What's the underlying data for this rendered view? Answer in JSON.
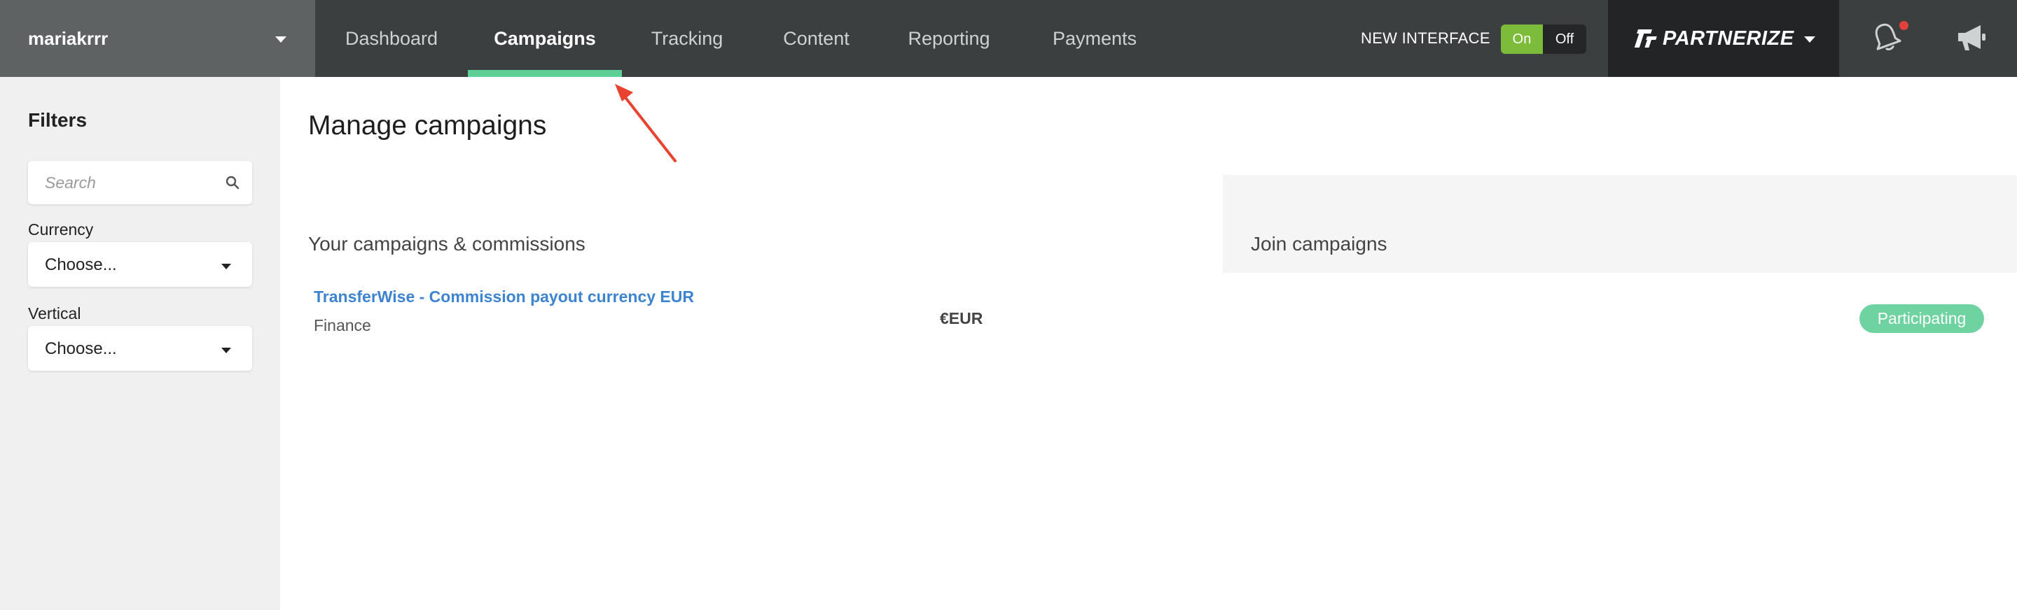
{
  "account": {
    "name": "mariakrrr"
  },
  "nav": {
    "items": [
      {
        "label": "Dashboard",
        "active": false
      },
      {
        "label": "Campaigns",
        "active": true
      },
      {
        "label": "Tracking",
        "active": false
      },
      {
        "label": "Content",
        "active": false
      },
      {
        "label": "Reporting",
        "active": false
      },
      {
        "label": "Payments",
        "active": false
      }
    ]
  },
  "interface_toggle": {
    "label": "NEW INTERFACE",
    "on_label": "On",
    "off_label": "Off",
    "selected": "On"
  },
  "brand": {
    "name": "PARTNERIZE"
  },
  "icons": {
    "account_caret": "chevron-down-icon",
    "bell": "bell-icon",
    "megaphone": "megaphone-icon",
    "search": "search-icon",
    "pointer": "arrow-annotation-icon"
  },
  "notifications": {
    "has_unread": true
  },
  "sidebar": {
    "title": "Filters",
    "search_placeholder": "Search",
    "currency": {
      "label": "Currency",
      "value": "Choose..."
    },
    "vertical": {
      "label": "Vertical",
      "value": "Choose..."
    }
  },
  "main": {
    "title": "Manage campaigns",
    "your_campaigns_title": "Your campaigns & commissions",
    "join_campaigns_title": "Join campaigns",
    "campaigns": [
      {
        "name": "TransferWise - Commission payout currency EUR",
        "vertical": "Finance",
        "currency": "€EUR",
        "status": "Participating"
      }
    ]
  },
  "colors": {
    "topbar": "#3c3f40",
    "account_bg": "#5f6263",
    "brand_bg": "#222425",
    "active_underline": "#5fcf98",
    "toggle_on": "#7dbc3a",
    "link": "#3c84cf",
    "badge": "#6fd3a1",
    "notification_dot": "#e0413a",
    "annotation_arrow": "#e8432f"
  }
}
